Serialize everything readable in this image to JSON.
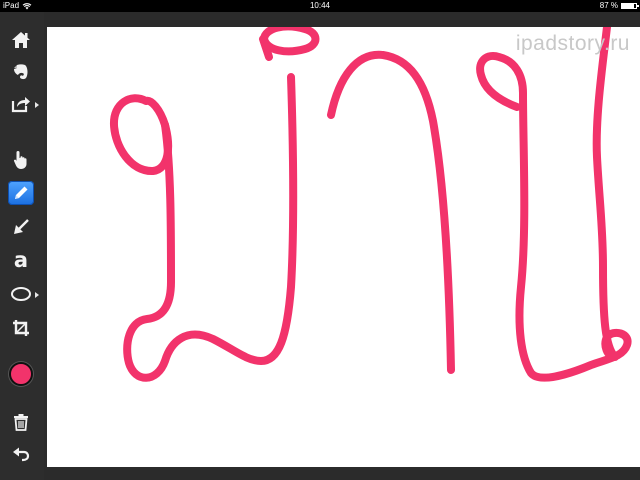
{
  "status_bar": {
    "device": "iPad",
    "time": "10:44",
    "battery_text": "87 %",
    "battery_level": 0.87
  },
  "toolbar": {
    "tools": [
      {
        "name": "home",
        "icon": "home-icon",
        "has_submenu": false,
        "selected": false
      },
      {
        "name": "evernote",
        "icon": "elephant-icon",
        "has_submenu": false,
        "selected": false
      },
      {
        "name": "share",
        "icon": "share-icon",
        "has_submenu": true,
        "selected": false
      },
      {
        "name": "hand",
        "icon": "hand-pointer-icon",
        "has_submenu": false,
        "selected": false
      },
      {
        "name": "pen",
        "icon": "pencil-icon",
        "has_submenu": false,
        "selected": true
      },
      {
        "name": "arrow",
        "icon": "arrow-icon",
        "has_submenu": false,
        "selected": false
      },
      {
        "name": "text",
        "icon": "text-icon",
        "has_submenu": false,
        "selected": false
      },
      {
        "name": "shape",
        "icon": "ellipse-icon",
        "has_submenu": true,
        "selected": false
      },
      {
        "name": "crop",
        "icon": "crop-icon",
        "has_submenu": false,
        "selected": false
      },
      {
        "name": "color",
        "icon": "color-swatch",
        "has_submenu": false,
        "selected": false
      },
      {
        "name": "delete",
        "icon": "trash-icon",
        "has_submenu": false,
        "selected": false
      },
      {
        "name": "undo",
        "icon": "undo-icon",
        "has_submenu": false,
        "selected": false
      }
    ],
    "text_tool_glyph": "a",
    "current_color": "#f2336b"
  },
  "canvas": {
    "background": "#ffffff",
    "stroke_color": "#f2336b",
    "watermark": "ipadstory.ru"
  }
}
